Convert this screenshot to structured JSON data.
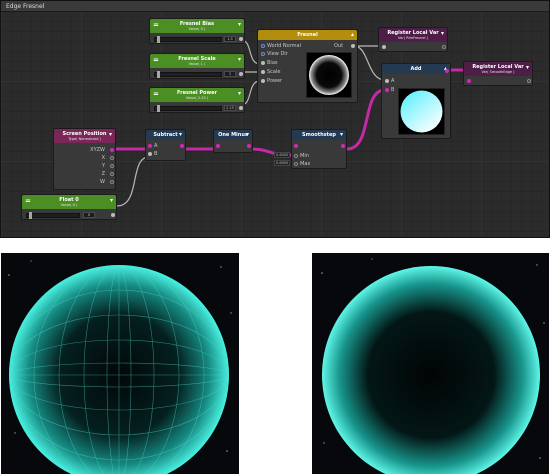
{
  "window": {
    "title": "Edge Fresnel"
  },
  "nodes": {
    "fresnel_bias": {
      "title": "Fresnel Bias",
      "sub": "Value( 0 )",
      "value": "1.5"
    },
    "fresnel_scale": {
      "title": "Fresnel Scale",
      "sub": "Value( 1 )",
      "value": "1"
    },
    "fresnel_power": {
      "title": "Fresnel Power",
      "sub": "Value( 2.25 )",
      "value": "2.25"
    },
    "fresnel": {
      "title": "Fresnel",
      "out": "Out",
      "inputs": [
        "World Normal",
        "View Dir",
        "Bias",
        "Scale",
        "Power"
      ]
    },
    "register1": {
      "title": "Register Local Var",
      "sub": "Var( RimFresnel )"
    },
    "register2": {
      "title": "Register Local Var",
      "sub": "Var( SmoothEdge )"
    },
    "add": {
      "title": "Add",
      "inputs": [
        "A",
        "B"
      ]
    },
    "screen_position": {
      "title": "Screen Position",
      "sub": "Type( Normalized )",
      "outputs": [
        "XYZW",
        "X",
        "Y",
        "Z",
        "W"
      ]
    },
    "subtract": {
      "title": "Subtract",
      "inputs": [
        "A",
        "B"
      ]
    },
    "one_minus": {
      "title": "One Minus"
    },
    "smoothstep": {
      "title": "Smoothstep",
      "inputs": [
        "Min",
        "Max"
      ],
      "min_value": "0.6000",
      "max_value": "0.6900"
    },
    "float0": {
      "title": "Float 0",
      "sub": "Value( 0 )",
      "value": "0"
    }
  },
  "colors": {
    "graph_bg": "#2b2b2b",
    "wire_purple": "#c22aa6",
    "wire_white": "#b9b9b9",
    "fresnel_header": "#b38e0e",
    "float_header": "#4a8e24",
    "screen_pos_header": "#7a2758",
    "math_header": "#243a52",
    "register_header": "#4e1e48",
    "glow": "#40e8d8"
  },
  "icons": {
    "chevron": "chevron-down-icon",
    "collapse": "chevron-up-icon",
    "float_property": "equals-icon"
  }
}
